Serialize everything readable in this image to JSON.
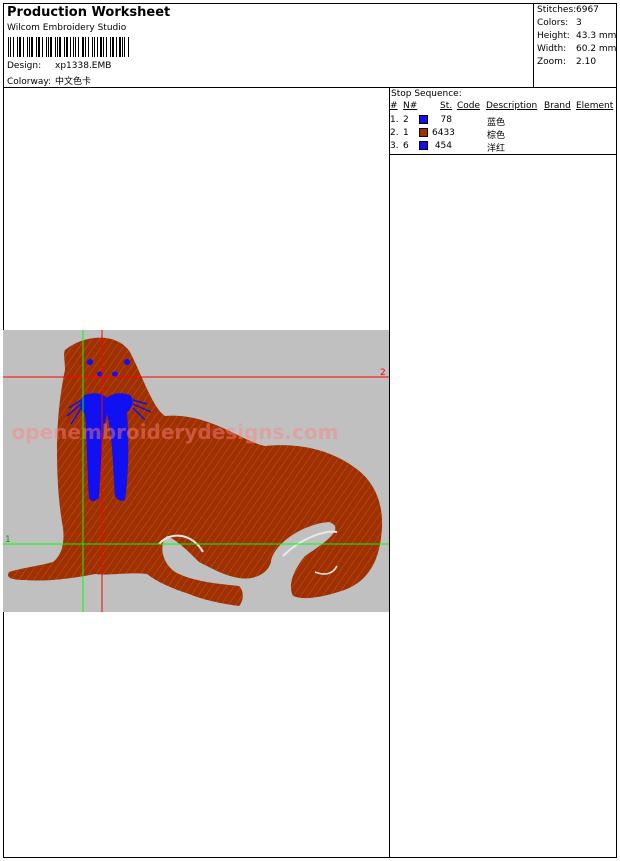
{
  "header": {
    "title": "Production Worksheet",
    "software": "Wilcom Embroidery Studio",
    "design_label": "Design:",
    "design_value": "xp1338.EMB",
    "colorway_label": "Colorway:",
    "colorway_value": "中文色卡"
  },
  "stats": {
    "stitches_label": "Stitches:",
    "stitches_value": "6967",
    "colors_label": "Colors:",
    "colors_value": "3",
    "height_label": "Height:",
    "height_value": "43.3 mm",
    "width_label": "Width:",
    "width_value": "60.2 mm",
    "zoom_label": "Zoom:",
    "zoom_value": "2.10"
  },
  "stop_sequence": {
    "title": "Stop Sequence:",
    "columns": [
      "#",
      "N#",
      "St.",
      "Code",
      "Description",
      "Brand",
      "Element"
    ],
    "rows": [
      {
        "index": "1.",
        "needle": "2",
        "code": "78",
        "description": "蓝色",
        "color": "#1010f0"
      },
      {
        "index": "2.",
        "needle": "1",
        "code": "6433",
        "description": "棕色",
        "color": "#a03000"
      },
      {
        "index": "3.",
        "needle": "6",
        "code": "454",
        "description": "洋红",
        "color": "#1010f0"
      }
    ]
  },
  "design_preview": {
    "watermark": "openembroiderydesigns.com",
    "marker_red": "2",
    "marker_green": "1",
    "background_color": "#c0c0c0",
    "body_color": "#a03000",
    "tusk_color": "#1010f0"
  }
}
